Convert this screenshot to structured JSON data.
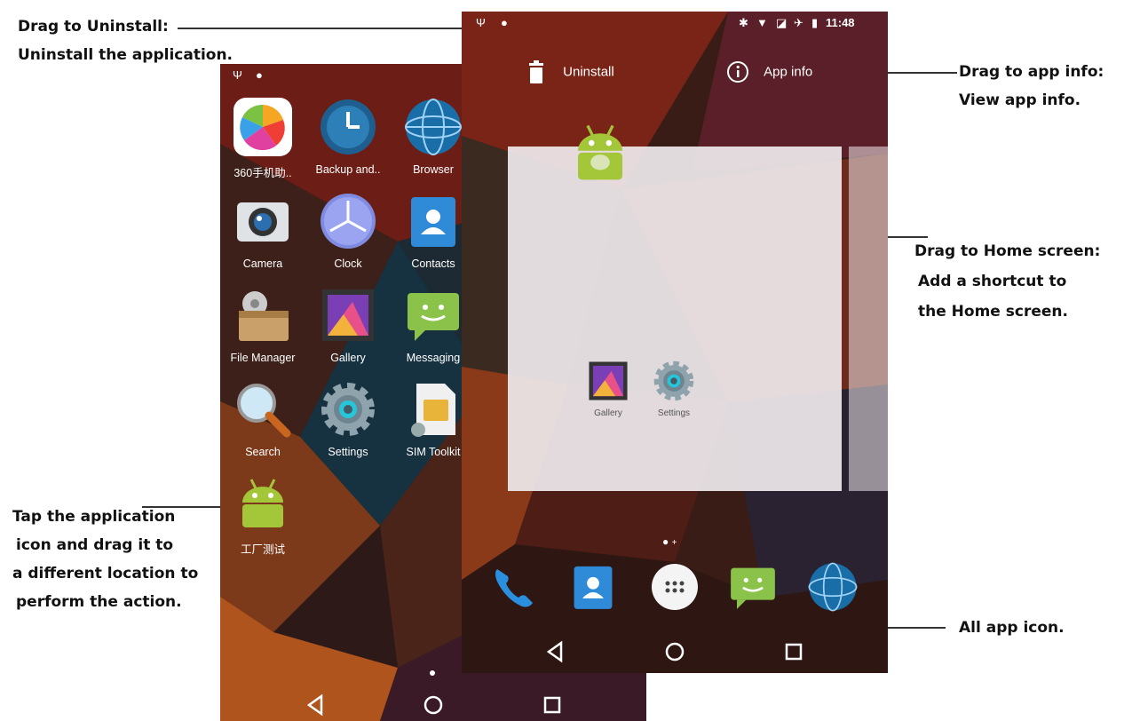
{
  "annotations": {
    "uninstall": {
      "line1": "Drag to Uninstall:",
      "line2": "Uninstall the application."
    },
    "app_info": {
      "line1": "Drag to app info:",
      "line2": "View app info."
    },
    "home_screen": {
      "line1": "Drag to Home screen:",
      "line2": "Add a shortcut to",
      "line3": "the Home screen."
    },
    "tap_drag": {
      "line1": "Tap the application",
      "line2": "icon and drag it to",
      "line3": "a different location to",
      "line4": "perform the action."
    },
    "all_apps": {
      "line1": "All app icon."
    }
  },
  "left_screen": {
    "apps": [
      {
        "label": "360手机助..",
        "icon": "360-assistant-icon"
      },
      {
        "label": "Backup and..",
        "icon": "backup-clock-icon"
      },
      {
        "label": "Browser",
        "icon": "globe-icon"
      },
      {
        "label": "Camera",
        "icon": "camera-icon"
      },
      {
        "label": "Clock",
        "icon": "clock-icon"
      },
      {
        "label": "Contacts",
        "icon": "contacts-icon"
      },
      {
        "label": "File Manager",
        "icon": "folder-icon"
      },
      {
        "label": "Gallery",
        "icon": "gallery-icon"
      },
      {
        "label": "Messaging",
        "icon": "message-icon"
      },
      {
        "label": "Search",
        "icon": "magnifier-icon"
      },
      {
        "label": "Settings",
        "icon": "gear-icon"
      },
      {
        "label": "SIM Toolkit",
        "icon": "sim-card-icon"
      },
      {
        "label": "工厂测试",
        "icon": "android-icon"
      }
    ]
  },
  "right_screen": {
    "status": {
      "time": "11:48"
    },
    "uninstall_label": "Uninstall",
    "app_info_label": "App info",
    "home_shortcuts": [
      {
        "label": "Gallery",
        "icon": "gallery-icon"
      },
      {
        "label": "Settings",
        "icon": "gear-icon"
      }
    ],
    "dock": [
      "phone-icon",
      "contacts-icon",
      "all-apps-icon",
      "message-icon",
      "globe-icon"
    ]
  },
  "colors": {
    "accent_green": "#a4c639",
    "wall_dark": "#2d1a18"
  }
}
